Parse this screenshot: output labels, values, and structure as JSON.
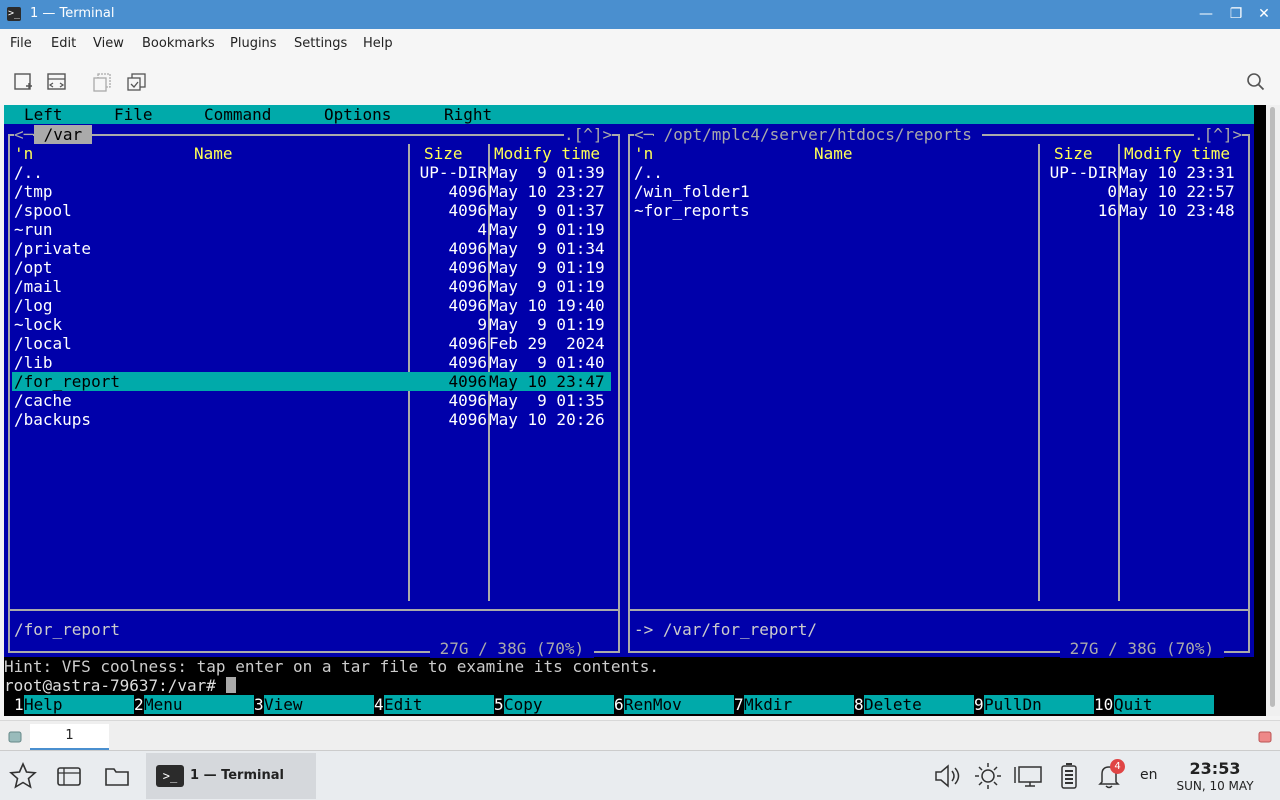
{
  "window": {
    "title": "1 — Terminal",
    "controls": {
      "minimize": "—",
      "restore": "❐",
      "close": "✕"
    }
  },
  "menubar": [
    "File",
    "Edit",
    "View",
    "Bookmarks",
    "Plugins",
    "Settings",
    "Help"
  ],
  "mc": {
    "menu": [
      "Left",
      "File",
      "Command",
      "Options",
      "Right"
    ],
    "left_panel": {
      "path": " /var ",
      "corner": ".[^]>",
      "left_corner": "<─",
      "headers": {
        "n": "'n",
        "name": "Name",
        "size": "Size",
        "mtime": "Modify time"
      },
      "rows": [
        {
          "name": "/..",
          "size": "UP--DIR",
          "mtime": "May  9 01:39"
        },
        {
          "name": "/tmp",
          "size": "4096",
          "mtime": "May 10 23:27"
        },
        {
          "name": "/spool",
          "size": "4096",
          "mtime": "May  9 01:37"
        },
        {
          "name": "~run",
          "size": "4",
          "mtime": "May  9 01:19"
        },
        {
          "name": "/private",
          "size": "4096",
          "mtime": "May  9 01:34"
        },
        {
          "name": "/opt",
          "size": "4096",
          "mtime": "May  9 01:19"
        },
        {
          "name": "/mail",
          "size": "4096",
          "mtime": "May  9 01:19"
        },
        {
          "name": "/log",
          "size": "4096",
          "mtime": "May 10 19:40"
        },
        {
          "name": "~lock",
          "size": "9",
          "mtime": "May  9 01:19"
        },
        {
          "name": "/local",
          "size": "4096",
          "mtime": "Feb 29  2024"
        },
        {
          "name": "/lib",
          "size": "4096",
          "mtime": "May  9 01:40"
        },
        {
          "name": "/for_report",
          "size": "4096",
          "mtime": "May 10 23:47",
          "selected": true
        },
        {
          "name": "/cache",
          "size": "4096",
          "mtime": "May  9 01:35"
        },
        {
          "name": "/backups",
          "size": "4096",
          "mtime": "May 10 20:26"
        }
      ],
      "mini_status": "/for_report",
      "disk": " 27G / 38G (70%) "
    },
    "right_panel": {
      "path": " /opt/mplc4/server/htdocs/reports ",
      "corner": ".[^]>",
      "left_corner": "<─",
      "headers": {
        "n": "'n",
        "name": "Name",
        "size": "Size",
        "mtime": "Modify time"
      },
      "rows": [
        {
          "name": "/..",
          "size": "UP--DIR",
          "mtime": "May 10 23:31"
        },
        {
          "name": "/win_folder1",
          "size": "0",
          "mtime": "May 10 22:57"
        },
        {
          "name": "~for_reports",
          "size": "16",
          "mtime": "May 10 23:48"
        }
      ],
      "mini_status": "-> /var/for_report/",
      "disk": " 27G / 38G (70%) "
    },
    "hint": "Hint: VFS coolness: tap enter on a tar file to examine its contents.",
    "prompt": "root@astra-79637:/var# ",
    "fkeys": [
      {
        "num": "1",
        "label": "Help"
      },
      {
        "num": "2",
        "label": "Menu"
      },
      {
        "num": "3",
        "label": "View"
      },
      {
        "num": "4",
        "label": "Edit"
      },
      {
        "num": "5",
        "label": "Copy"
      },
      {
        "num": "6",
        "label": "RenMov"
      },
      {
        "num": "7",
        "label": "Mkdir"
      },
      {
        "num": "8",
        "label": "Delete"
      },
      {
        "num": "9",
        "label": "PullDn"
      },
      {
        "num": "10",
        "label": "Quit"
      }
    ]
  },
  "tabs": [
    "1"
  ],
  "taskbar": {
    "active_task": "1 — Terminal",
    "notification_count": "4",
    "language": "en",
    "time": "23:53",
    "date": "SUN, 10 MAY"
  },
  "colors": {
    "mc_blue": "#0000aa",
    "mc_cyan": "#00aaaa",
    "mc_yellow": "#ffff55",
    "titlebar": "#4a8fcf"
  }
}
